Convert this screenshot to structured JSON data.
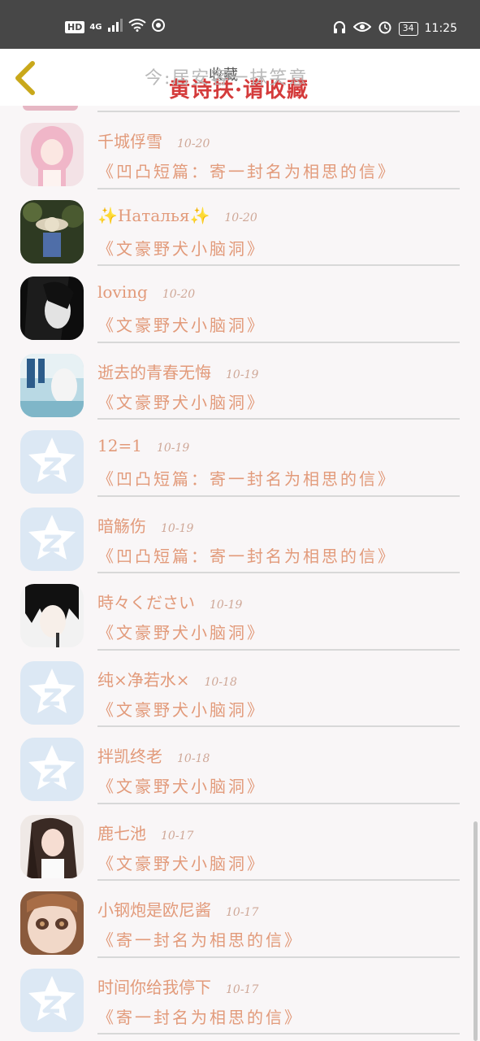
{
  "status_bar": {
    "hd": "HD",
    "network": "4G",
    "time": "11:25",
    "battery": "34"
  },
  "header": {
    "title": "收藏",
    "overlay_title": "黄诗扶·请收藏",
    "subtitle": "今:居安客一抹笑意"
  },
  "rows": [
    {
      "name": "千城俘雪",
      "date": "10-20",
      "book": "《凹凸短篇：寄一封名为相思的信》",
      "avatar": "pink-hair-girl"
    },
    {
      "name": "✨Наталья✨",
      "date": "10-20",
      "book": "《文豪野犬小脑洞》",
      "avatar": "straw-hat-forest"
    },
    {
      "name": "loving",
      "date": "10-20",
      "book": "《文豪野犬小脑洞》",
      "avatar": "bw-portrait"
    },
    {
      "name": "逝去的青春无悔",
      "date": "10-19",
      "book": "《文豪野犬小脑洞》",
      "avatar": "book-cover"
    },
    {
      "name": "12=1",
      "date": "10-19",
      "book": "《凹凸短篇：寄一封名为相思的信》",
      "avatar": "default-star"
    },
    {
      "name": "暗觞伤",
      "date": "10-19",
      "book": "《凹凸短篇：寄一封名为相思的信》",
      "avatar": "default-star"
    },
    {
      "name": "時々ください",
      "date": "10-19",
      "book": "《文豪野犬小脑洞》",
      "avatar": "anime-boy"
    },
    {
      "name": "纯×净若水×",
      "date": "10-18",
      "book": "《文豪野犬小脑洞》",
      "avatar": "default-star"
    },
    {
      "name": "拌凯终老",
      "date": "10-18",
      "book": "《文豪野犬小脑洞》",
      "avatar": "default-star"
    },
    {
      "name": "鹿七池",
      "date": "10-17",
      "book": "《文豪野犬小脑洞》",
      "avatar": "long-hair-girl"
    },
    {
      "name": "小钢炮是欧尼酱",
      "date": "10-17",
      "book": "《寄一封名为相思的信》",
      "avatar": "doll-face"
    },
    {
      "name": "时间你给我停下",
      "date": "10-17",
      "book": "《寄一封名为相思的信》",
      "avatar": "default-star"
    }
  ],
  "colors": {
    "accent_text": "#e29a7a",
    "default_avatar": "#dce8f4",
    "overlay_red": "#d43b3b"
  }
}
